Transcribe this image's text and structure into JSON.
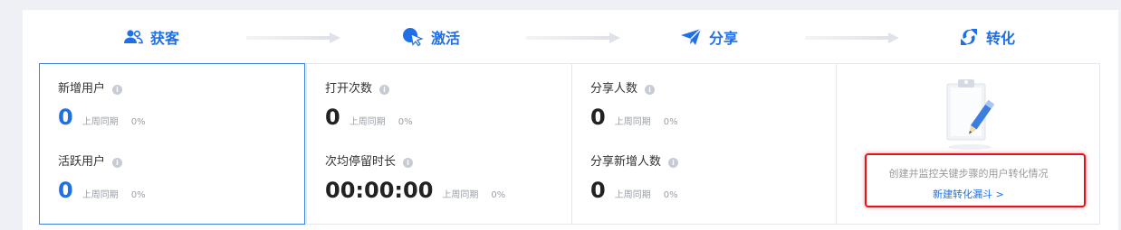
{
  "stages": [
    {
      "label": "获客",
      "icon": "users-icon"
    },
    {
      "label": "激活",
      "icon": "cursor-click-icon"
    },
    {
      "label": "分享",
      "icon": "paper-plane-icon"
    },
    {
      "label": "转化",
      "icon": "sync-icon"
    }
  ],
  "acquisition": {
    "new_users": {
      "label": "新增用户",
      "value": "0",
      "compare": "上周同期",
      "pct": "0%"
    },
    "active_users": {
      "label": "活跃用户",
      "value": "0",
      "compare": "上周同期",
      "pct": "0%"
    }
  },
  "activation": {
    "opens": {
      "label": "打开次数",
      "value": "0",
      "compare": "上周同期",
      "pct": "0%"
    },
    "avg_duration": {
      "label": "次均停留时长",
      "value": "00:00:00",
      "compare": "上周同期",
      "pct": "0%"
    }
  },
  "sharing": {
    "sharers": {
      "label": "分享人数",
      "value": "0",
      "compare": "上周同期",
      "pct": "0%"
    },
    "share_new_users": {
      "label": "分享新增人数",
      "value": "0",
      "compare": "上周同期",
      "pct": "0%"
    }
  },
  "conversion": {
    "icon": "clipboard-pencil-icon",
    "description": "创建并监控关键步骤的用户转化情况",
    "link": "新建转化漏斗 >"
  },
  "colors": {
    "accent": "#1f6fe5",
    "highlight": "#e3131b",
    "background": "#eef0f5"
  }
}
